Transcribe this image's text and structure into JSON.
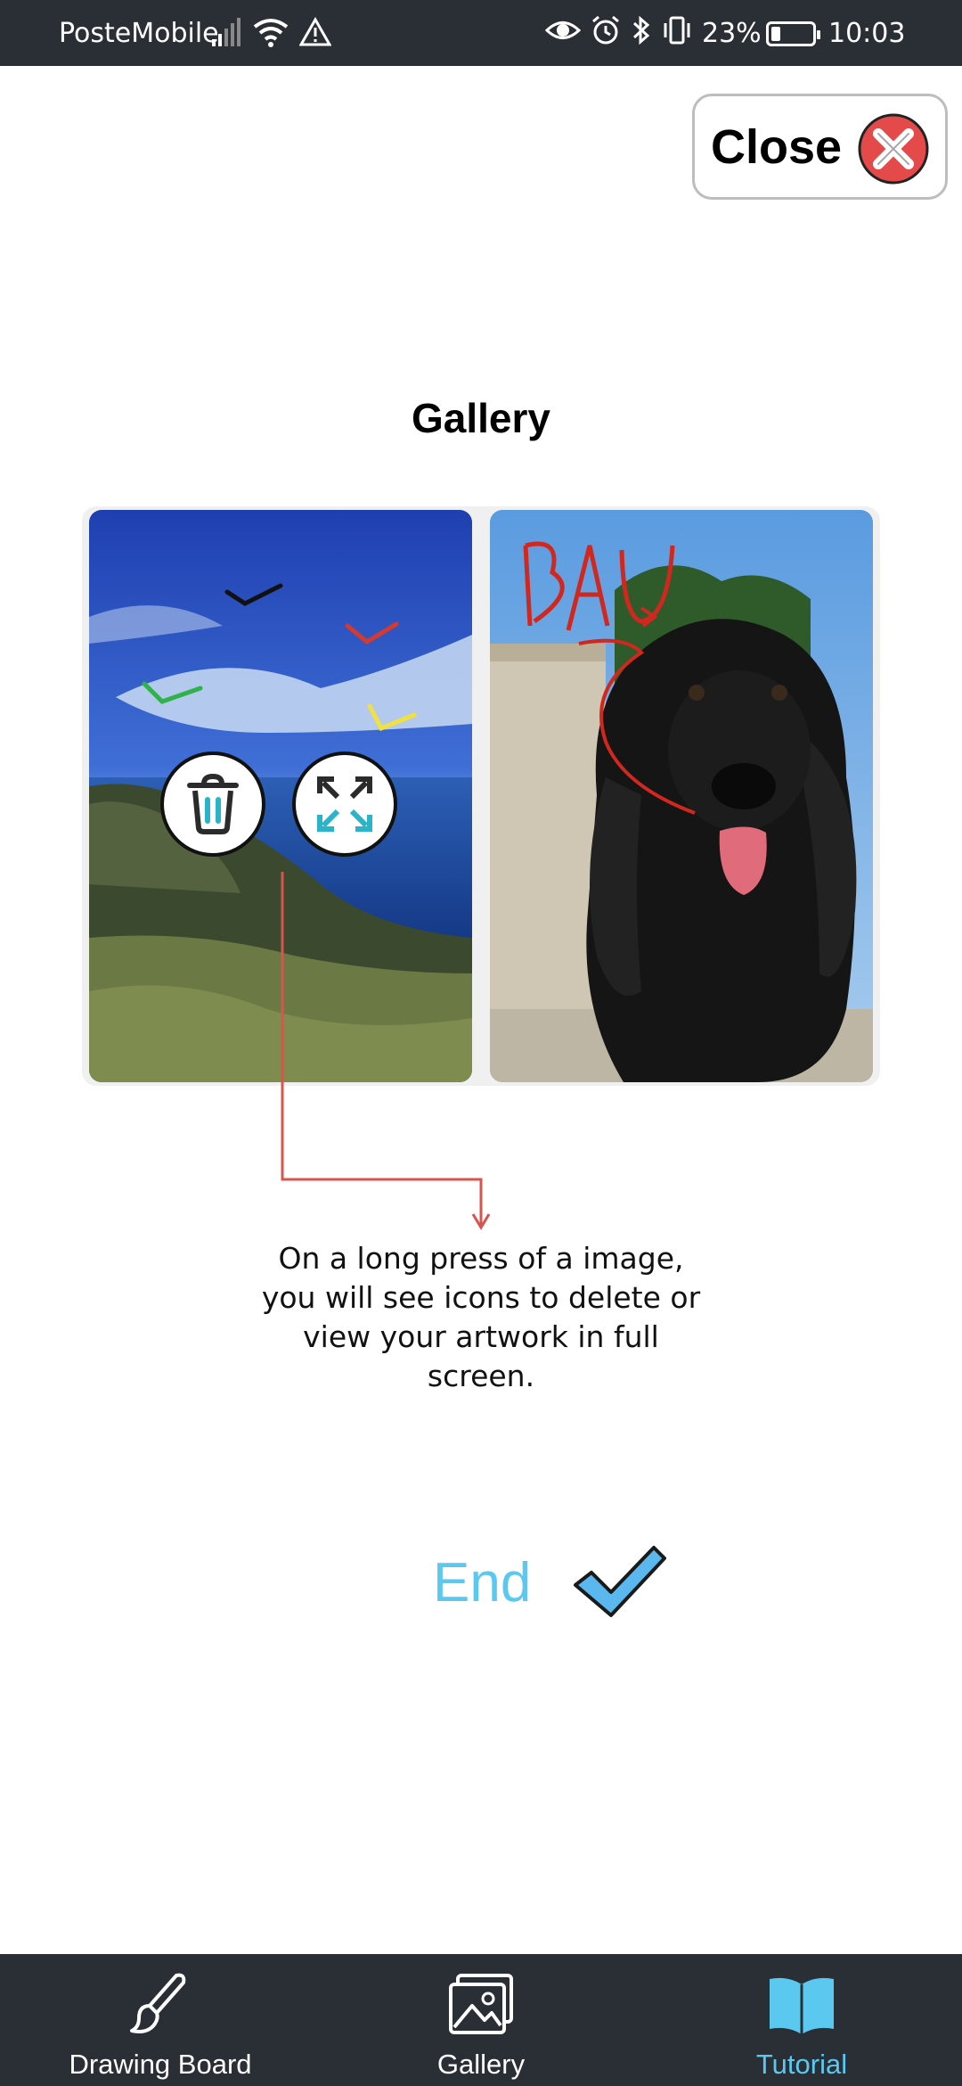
{
  "status_bar": {
    "carrier": "PosteMobile",
    "battery": "23%",
    "battery_level": 0.23,
    "time": "10:03",
    "icons": [
      "signal-icon",
      "wifi-icon",
      "warning-icon",
      "eye-icon",
      "alarm-icon",
      "bluetooth-icon",
      "vibrate-icon",
      "battery-icon"
    ]
  },
  "close_button": {
    "label": "Close",
    "icon": "close-icon"
  },
  "page_title": "Gallery",
  "gallery": {
    "images": [
      {
        "subject": "coastal landscape with drawn checkmarks"
      },
      {
        "subject": "black spaniel dog with drawn text",
        "drawn_text": "BAU"
      }
    ],
    "actions": [
      "delete-icon",
      "fullscreen-icon"
    ]
  },
  "description": "On a long press of a image, you will see icons to delete or view your artwork in full screen.",
  "end_button": {
    "label": "End",
    "icon": "checkmark-icon"
  },
  "bottom_nav": {
    "items": [
      {
        "label": "Drawing Board",
        "icon": "brush-icon",
        "active": false
      },
      {
        "label": "Gallery",
        "icon": "image-icon",
        "active": false
      },
      {
        "label": "Tutorial",
        "icon": "book-icon",
        "active": true
      }
    ]
  },
  "colors": {
    "status_bar_bg": "#2a2f36",
    "accent": "#5bc8ef",
    "close_icon_red": "#e44a4a",
    "annotation_red": "#d9534f"
  }
}
